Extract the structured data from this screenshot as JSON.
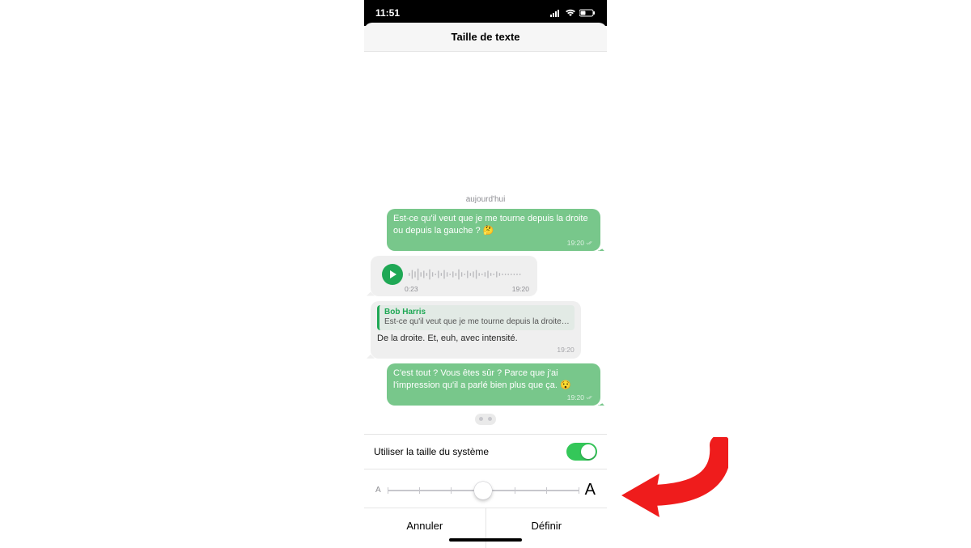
{
  "status": {
    "time": "11:51"
  },
  "header": {
    "title": "Taille de texte"
  },
  "chat": {
    "date_label": "aujourd'hui",
    "msg1": {
      "text": "Est-ce qu'il veut que je me tourne depuis la droite ou depuis la gauche ? 🤔",
      "time": "19:20"
    },
    "voice": {
      "duration": "0:23",
      "time": "19:20"
    },
    "msg2": {
      "quote_name": "Bob Harris",
      "quote_text": "Est-ce qu'il veut que je me tourne depuis la droite…",
      "text": "De la droite. Et, euh, avec intensité.",
      "time": "19:20"
    },
    "msg3": {
      "text": "C'est tout ? Vous êtes sûr ? Parce que j'ai l'impression qu'il a parlé bien plus que ça. 😯",
      "time": "19:20"
    }
  },
  "settings": {
    "system_size_label": "Utiliser la taille du système",
    "slider": {
      "small": "A",
      "big": "A",
      "ticks": 7,
      "thumb_index": 3
    }
  },
  "buttons": {
    "cancel": "Annuler",
    "set": "Définir"
  }
}
